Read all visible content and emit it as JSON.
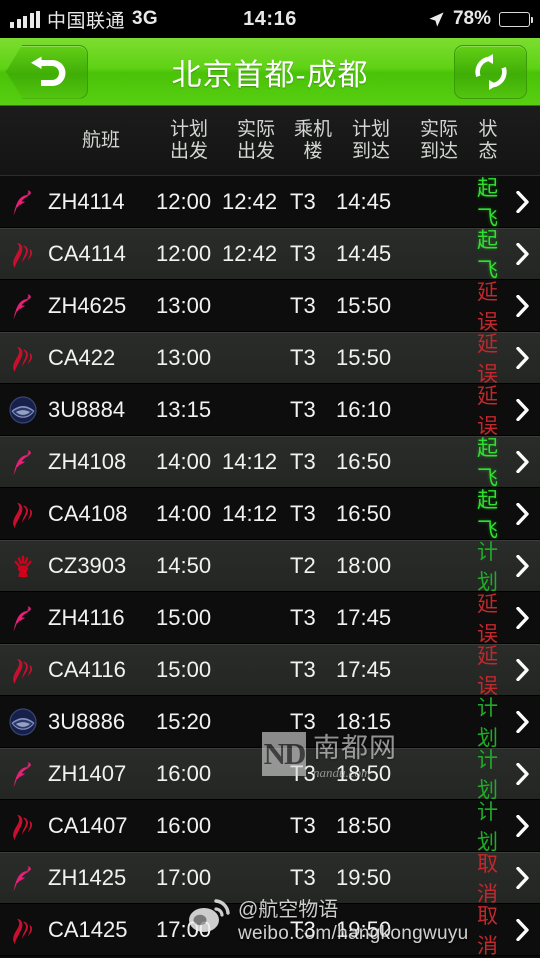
{
  "statusbar": {
    "signal_icon": "signal-bars-icon",
    "carrier": "中国联通",
    "network": "3G",
    "time": "14:16",
    "location_icon": "location-arrow-icon",
    "battery_percent": "78%",
    "battery_icon": "battery-icon"
  },
  "navbar": {
    "back_icon": "back-arrow-icon",
    "title": "北京首都-成都",
    "refresh_icon": "refresh-icon"
  },
  "table": {
    "headers": {
      "flight": "航班",
      "planned_departure": "计划\n出发",
      "planned_departure_l1": "计划",
      "planned_departure_l2": "出发",
      "actual_departure_l1": "实际",
      "actual_departure_l2": "出发",
      "terminal_l1": "乘机",
      "terminal_l2": "楼",
      "planned_arrival_l1": "计划",
      "planned_arrival_l2": "到达",
      "actual_arrival_l1": "实际",
      "actual_arrival_l2": "到达",
      "status": "状态"
    },
    "status_colors": {
      "departed": "#2fe02f",
      "scheduled": "#1faa28",
      "delayed": "#c2282c",
      "cancelled": "#c2282c"
    },
    "rows": [
      {
        "logo": "shenzhen-airlines-logo",
        "flight": "ZH4114",
        "planned_departure": "12:00",
        "actual_departure": "12:42",
        "terminal": "T3",
        "planned_arrival": "14:45",
        "actual_arrival": "",
        "status": "起飞",
        "status_class": "st-green"
      },
      {
        "logo": "air-china-logo",
        "flight": "CA4114",
        "planned_departure": "12:00",
        "actual_departure": "12:42",
        "terminal": "T3",
        "planned_arrival": "14:45",
        "actual_arrival": "",
        "status": "起飞",
        "status_class": "st-green"
      },
      {
        "logo": "shenzhen-airlines-logo",
        "flight": "ZH4625",
        "planned_departure": "13:00",
        "actual_departure": "",
        "terminal": "T3",
        "planned_arrival": "15:50",
        "actual_arrival": "",
        "status": "延误",
        "status_class": "st-red"
      },
      {
        "logo": "air-china-logo",
        "flight": "CA422",
        "planned_departure": "13:00",
        "actual_departure": "",
        "terminal": "T3",
        "planned_arrival": "15:50",
        "actual_arrival": "",
        "status": "延误",
        "status_class": "st-red"
      },
      {
        "logo": "sichuan-airlines-logo",
        "flight": "3U8884",
        "planned_departure": "13:15",
        "actual_departure": "",
        "terminal": "T3",
        "planned_arrival": "16:10",
        "actual_arrival": "",
        "status": "延误",
        "status_class": "st-red"
      },
      {
        "logo": "shenzhen-airlines-logo",
        "flight": "ZH4108",
        "planned_departure": "14:00",
        "actual_departure": "14:12",
        "terminal": "T3",
        "planned_arrival": "16:50",
        "actual_arrival": "",
        "status": "起飞",
        "status_class": "st-green"
      },
      {
        "logo": "air-china-logo",
        "flight": "CA4108",
        "planned_departure": "14:00",
        "actual_departure": "14:12",
        "terminal": "T3",
        "planned_arrival": "16:50",
        "actual_arrival": "",
        "status": "起飞",
        "status_class": "st-green"
      },
      {
        "logo": "china-southern-logo",
        "flight": "CZ3903",
        "planned_departure": "14:50",
        "actual_departure": "",
        "terminal": "T2",
        "planned_arrival": "18:00",
        "actual_arrival": "",
        "status": "计划",
        "status_class": "st-dgreen"
      },
      {
        "logo": "shenzhen-airlines-logo",
        "flight": "ZH4116",
        "planned_departure": "15:00",
        "actual_departure": "",
        "terminal": "T3",
        "planned_arrival": "17:45",
        "actual_arrival": "",
        "status": "延误",
        "status_class": "st-red"
      },
      {
        "logo": "air-china-logo",
        "flight": "CA4116",
        "planned_departure": "15:00",
        "actual_departure": "",
        "terminal": "T3",
        "planned_arrival": "17:45",
        "actual_arrival": "",
        "status": "延误",
        "status_class": "st-red"
      },
      {
        "logo": "sichuan-airlines-logo",
        "flight": "3U8886",
        "planned_departure": "15:20",
        "actual_departure": "",
        "terminal": "T3",
        "planned_arrival": "18:15",
        "actual_arrival": "",
        "status": "计划",
        "status_class": "st-dgreen"
      },
      {
        "logo": "shenzhen-airlines-logo",
        "flight": "ZH1407",
        "planned_departure": "16:00",
        "actual_departure": "",
        "terminal": "T3",
        "planned_arrival": "18:50",
        "actual_arrival": "",
        "status": "计划",
        "status_class": "st-dgreen"
      },
      {
        "logo": "air-china-logo",
        "flight": "CA1407",
        "planned_departure": "16:00",
        "actual_departure": "",
        "terminal": "T3",
        "planned_arrival": "18:50",
        "actual_arrival": "",
        "status": "计划",
        "status_class": "st-dgreen"
      },
      {
        "logo": "shenzhen-airlines-logo",
        "flight": "ZH1425",
        "planned_departure": "17:00",
        "actual_departure": "",
        "terminal": "T3",
        "planned_arrival": "19:50",
        "actual_arrival": "",
        "status": "取消",
        "status_class": "st-red"
      },
      {
        "logo": "air-china-logo",
        "flight": "CA1425",
        "planned_departure": "17:00",
        "actual_departure": "",
        "terminal": "T3",
        "planned_arrival": "19:50",
        "actual_arrival": "",
        "status": "取消",
        "status_class": "st-red"
      }
    ]
  },
  "watermarks": {
    "nandu_mark": "ND",
    "nandu_name": "南都网",
    "nandu_url": "nandu.com",
    "weibo_handle": "@航空物语",
    "weibo_url": "weibo.com/hangkongwuyu"
  }
}
